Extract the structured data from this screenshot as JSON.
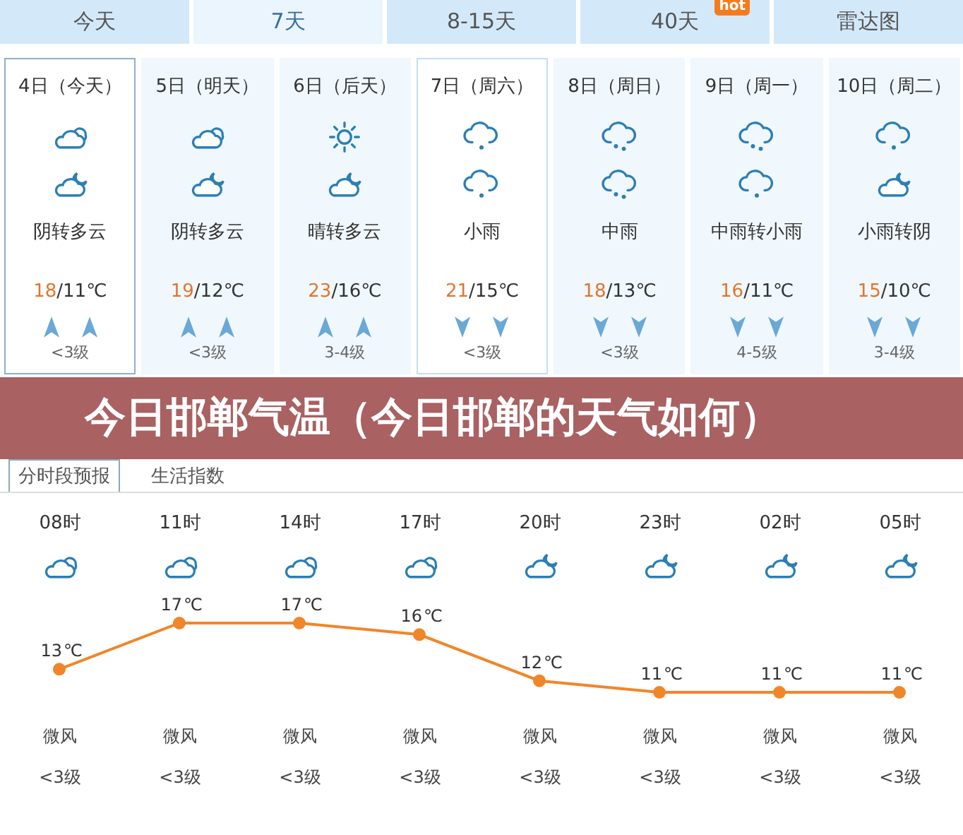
{
  "tabs": [
    {
      "label": "今天",
      "selected": false
    },
    {
      "label": "7天",
      "selected": true
    },
    {
      "label": "8-15天",
      "selected": false
    },
    {
      "label": "40天",
      "selected": false,
      "badge": "hot"
    },
    {
      "label": "雷达图",
      "selected": false
    }
  ],
  "days": [
    {
      "date": "4日（今天）",
      "icons": [
        {
          "kind": "overcast"
        },
        {
          "kind": "cloud-moon"
        }
      ],
      "desc": "阴转多云",
      "high": "18",
      "low": "/11℃",
      "arrows": [
        {
          "kind": "up"
        },
        {
          "kind": "up"
        }
      ],
      "wind_level": "<3级",
      "outlined": true,
      "selected": true
    },
    {
      "date": "5日（明天）",
      "icons": [
        {
          "kind": "overcast"
        },
        {
          "kind": "cloud-moon"
        }
      ],
      "desc": "阴转多云",
      "high": "19",
      "low": "/12℃",
      "arrows": [
        {
          "kind": "up"
        },
        {
          "kind": "up"
        }
      ],
      "wind_level": "<3级",
      "outlined": false,
      "selected": false
    },
    {
      "date": "6日（后天）",
      "icons": [
        {
          "kind": "sunny"
        },
        {
          "kind": "cloud-moon"
        }
      ],
      "desc": "晴转多云",
      "high": "23",
      "low": "/16℃",
      "arrows": [
        {
          "kind": "up"
        },
        {
          "kind": "up"
        }
      ],
      "wind_level": "3-4级",
      "outlined": false,
      "selected": false
    },
    {
      "date": "7日（周六）",
      "icons": [
        {
          "kind": "light-rain"
        },
        {
          "kind": "light-rain"
        }
      ],
      "desc": "小雨",
      "high": "21",
      "low": "/15℃",
      "arrows": [
        {
          "kind": "down"
        },
        {
          "kind": "down"
        }
      ],
      "wind_level": "<3级",
      "outlined": true,
      "selected": false
    },
    {
      "date": "8日（周日）",
      "icons": [
        {
          "kind": "moderate-rain"
        },
        {
          "kind": "moderate-rain"
        }
      ],
      "desc": "中雨",
      "high": "18",
      "low": "/13℃",
      "arrows": [
        {
          "kind": "down"
        },
        {
          "kind": "down"
        }
      ],
      "wind_level": "<3级",
      "outlined": false,
      "selected": false
    },
    {
      "date": "9日（周一）",
      "icons": [
        {
          "kind": "moderate-rain"
        },
        {
          "kind": "light-rain"
        }
      ],
      "desc": "中雨转小雨",
      "high": "16",
      "low": "/11℃",
      "arrows": [
        {
          "kind": "down"
        },
        {
          "kind": "down"
        }
      ],
      "wind_level": "4-5级",
      "outlined": false,
      "selected": false
    },
    {
      "date": "10日（周二）",
      "icons": [
        {
          "kind": "light-rain"
        },
        {
          "kind": "cloud-moon"
        }
      ],
      "desc": "小雨转阴",
      "high": "15",
      "low": "/10℃",
      "arrows": [
        {
          "kind": "down"
        },
        {
          "kind": "down"
        }
      ],
      "wind_level": "3-4级",
      "outlined": false,
      "selected": false
    }
  ],
  "banner": {
    "title": "今日邯郸气温（今日邯郸的天气如何）"
  },
  "subtabs": [
    {
      "label": "分时段预报",
      "selected": true
    },
    {
      "label": "生活指数",
      "selected": false
    }
  ],
  "hourly": [
    {
      "hour": "08时",
      "kind": "overcast",
      "unit": "℃",
      "wind": "微风",
      "level": "<3级"
    },
    {
      "hour": "11时",
      "kind": "overcast",
      "unit": "℃",
      "wind": "微风",
      "level": "<3级"
    },
    {
      "hour": "14时",
      "kind": "overcast",
      "unit": "℃",
      "wind": "微风",
      "level": "<3级"
    },
    {
      "hour": "17时",
      "kind": "overcast",
      "unit": "℃",
      "wind": "微风",
      "level": "<3级"
    },
    {
      "hour": "20时",
      "kind": "cloud-moon",
      "unit": "℃",
      "wind": "微风",
      "level": "<3级"
    },
    {
      "hour": "23时",
      "kind": "cloud-moon",
      "unit": "℃",
      "wind": "微风",
      "level": "<3级"
    },
    {
      "hour": "02时",
      "kind": "cloud-moon",
      "unit": "℃",
      "wind": "微风",
      "level": "<3级"
    },
    {
      "hour": "05时",
      "kind": "cloud-moon",
      "unit": "℃",
      "wind": "微风",
      "level": "<3级"
    }
  ],
  "chart_data": {
    "type": "line",
    "series": [
      {
        "color": "#f0862a",
        "marker": "circle",
        "values": [
          13,
          17,
          17,
          16,
          12,
          11,
          11,
          11
        ]
      }
    ],
    "data_labels": true
  }
}
